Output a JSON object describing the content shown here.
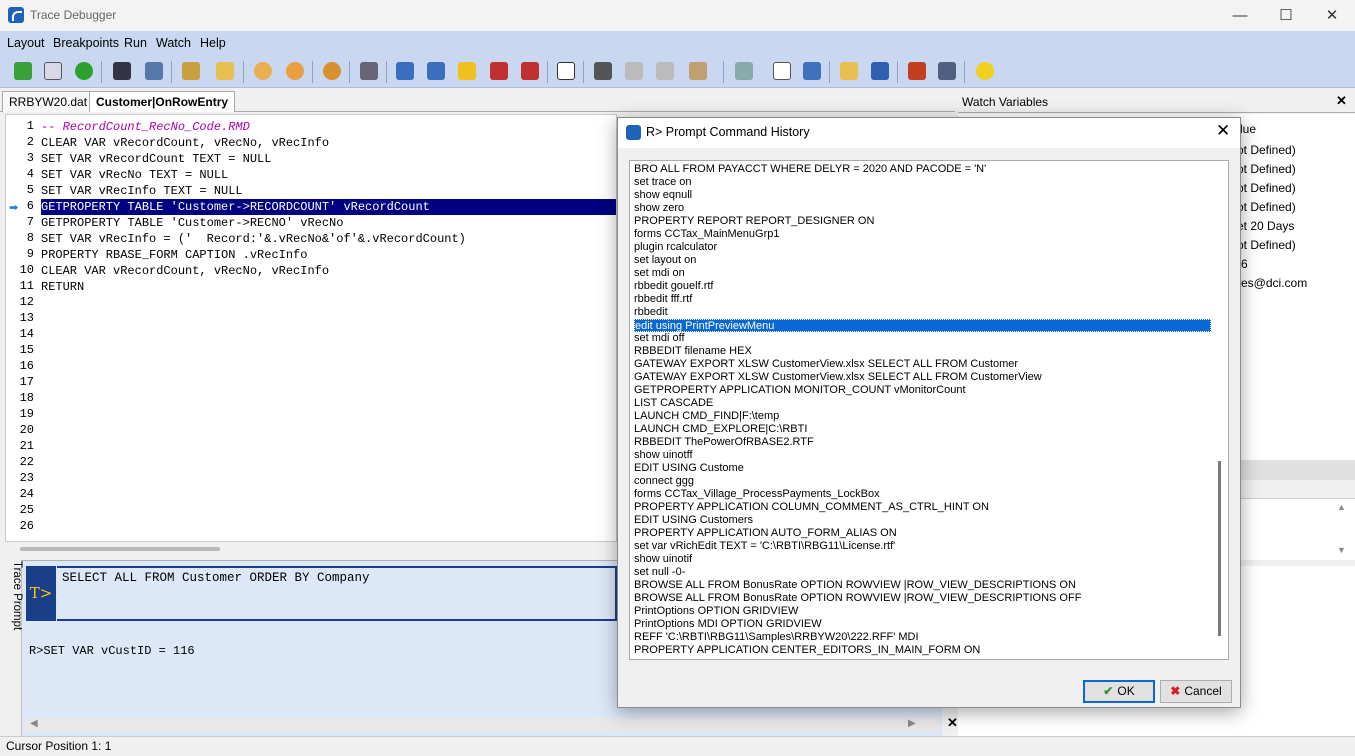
{
  "window": {
    "title": "Trace Debugger",
    "minimize": "—",
    "maximize": "☐",
    "close": "✕"
  },
  "menu": [
    "Layout",
    "Breakpoints",
    "Run",
    "Watch",
    "Help"
  ],
  "tabs": [
    {
      "label": "RRBYW20.dat"
    },
    {
      "label": "Customer|OnRowEntry"
    }
  ],
  "editor": {
    "line_numbers": [
      "1",
      "2",
      "3",
      "4",
      "5",
      "6",
      "7",
      "8",
      "9",
      "10",
      "11",
      "12",
      "13",
      "14",
      "15",
      "16",
      "17",
      "18",
      "19",
      "20",
      "21",
      "22",
      "23",
      "24",
      "25",
      "26"
    ],
    "current_line": "6",
    "lines": [
      "-- RecordCount_RecNo_Code.RMD",
      "CLEAR VAR vRecordCount, vRecNo, vRecInfo",
      "SET VAR vRecordCount TEXT = NULL",
      "SET VAR vRecNo TEXT = NULL",
      "SET VAR vRecInfo TEXT = NULL",
      "GETPROPERTY TABLE 'Customer->RECORDCOUNT' vRecordCount",
      "GETPROPERTY TABLE 'Customer->RECNO' vRecNo",
      "SET VAR vRecInfo = ('  Record:'&.vRecNo&'of'&.vRecordCount)",
      "PROPERTY RBASE_FORM CAPTION .vRecInfo",
      "CLEAR VAR vRecordCount, vRecNo, vRecInfo",
      "RETURN"
    ]
  },
  "trace_prompt": {
    "side_label": "Trace Prompt",
    "icon_label": "T>",
    "input": "SELECT ALL FROM Customer ORDER BY Company",
    "output": "R>SET VAR vCustID = 116"
  },
  "watch": {
    "title": "Watch Variables",
    "close": "✕",
    "visible_values": [
      "lue",
      "ot Defined)",
      "ot Defined)",
      "ot Defined)",
      "ot Defined)",
      "et 20 Days",
      "ot Defined)",
      "6",
      "es@dci.com"
    ]
  },
  "status": {
    "text": "Cursor Position 1: 1"
  },
  "dialog": {
    "title": "R> Prompt Command History",
    "close": "✕",
    "items": [
      "BRO ALL FROM PAYACCT WHERE DELYR = 2020  AND PACODE = 'N'",
      "set trace on",
      "show eqnull",
      "show zero",
      "PROPERTY REPORT REPORT_DESIGNER ON",
      "forms CCTax_MainMenuGrp1",
      "plugin rcalculator",
      "set layout on",
      "set mdi on",
      "rbbedit gouelf.rtf",
      "rbbedit fff.rtf",
      "rbbedit",
      "edit using PrintPreviewMenu",
      "set mdi off",
      "RBBEDIT filename HEX",
      "GATEWAY EXPORT XLSW CustomerView.xlsx SELECT ALL FROM Customer",
      "GATEWAY EXPORT XLSW CustomerView.xlsx SELECT ALL FROM CustomerView",
      "GETPROPERTY APPLICATION MONITOR_COUNT vMonitorCount",
      "LIST CASCADE",
      "LAUNCH CMD_FIND|F:\\temp",
      "LAUNCH CMD_EXPLORE|C:\\RBTI",
      "RBBEDIT ThePowerOfRBASE2.RTF",
      "show uinotff",
      "EDIT USING Custome",
      "connect ggg",
      "forms CCTax_Village_ProcessPayments_LockBox",
      "PROPERTY APPLICATION COLUMN_COMMENT_AS_CTRL_HINT ON",
      "EDIT USING Customers",
      "PROPERTY APPLICATION AUTO_FORM_ALIAS ON",
      "set var vRichEdit TEXT = 'C:\\RBTI\\RBG11\\License.rtf'",
      "show uinotif",
      "set null -0-",
      "BROWSE ALL FROM BonusRate OPTION ROWVIEW |ROW_VIEW_DESCRIPTIONS ON",
      "BROWSE ALL FROM BonusRate OPTION ROWVIEW |ROW_VIEW_DESCRIPTIONS OFF",
      "PrintOptions OPTION GRIDVIEW",
      "PrintOptions MDI OPTION GRIDVIEW",
      "REFF 'C:\\RBTI\\RBG11\\Samples\\RRBYW20\\222.RFF' MDI",
      "PROPERTY APPLICATION CENTER_EDITORS_IN_MAIN_FORM ON"
    ],
    "selected_index": 12,
    "ok_label": "OK",
    "cancel_label": "Cancel"
  },
  "colors": {
    "toolbar_bg": "#c9d8f0",
    "highlight": "#000080",
    "selection": "#0a68d6"
  }
}
